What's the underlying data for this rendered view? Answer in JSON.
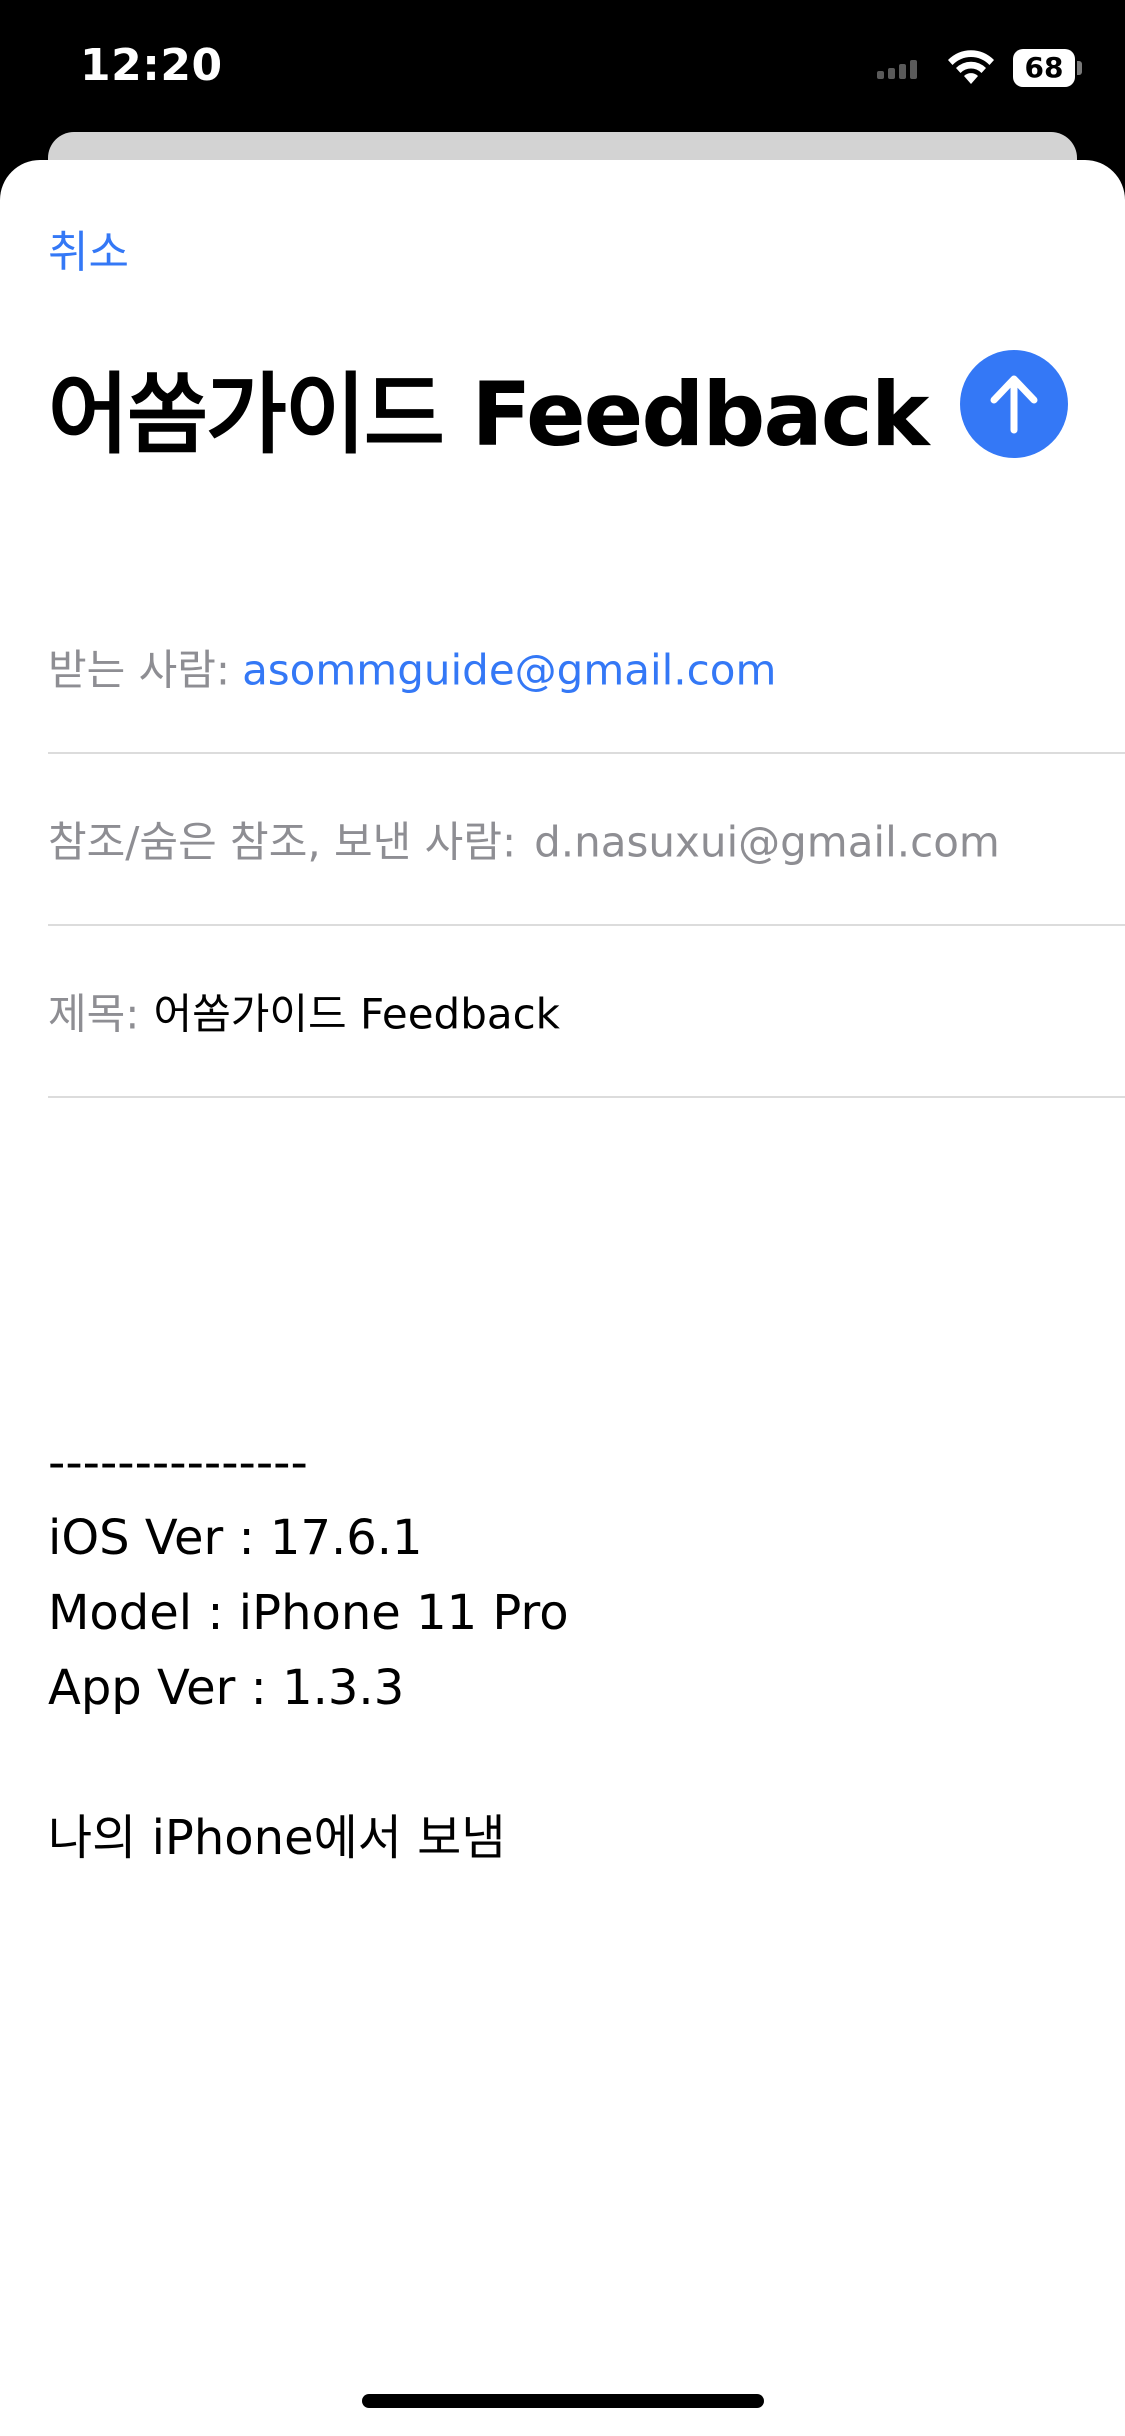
{
  "status_bar": {
    "time": "12:20",
    "battery": "68",
    "icons": [
      "cellular-signal-icon",
      "wifi-icon",
      "battery-icon"
    ]
  },
  "compose": {
    "cancel_label": "취소",
    "title": "어쏨가이드 Feedback",
    "send_icon": "arrow-up-icon",
    "accent_color": "#3478f6",
    "to": {
      "label": "받는 사람:",
      "value": "asommguide@gmail.com"
    },
    "cc": {
      "label": "참조/숨은 참조, 보낸 사람:",
      "value": "d.nasuxui@gmail.com"
    },
    "subject": {
      "label": "제목:",
      "value": "어쏨가이드 Feedback"
    },
    "body": {
      "divider": "---------------",
      "ios_version": "iOS Ver : 17.6.1",
      "model": "Model : iPhone 11 Pro",
      "app_version": "App Ver : 1.3.3",
      "signature": "나의 iPhone에서 보냄"
    }
  }
}
